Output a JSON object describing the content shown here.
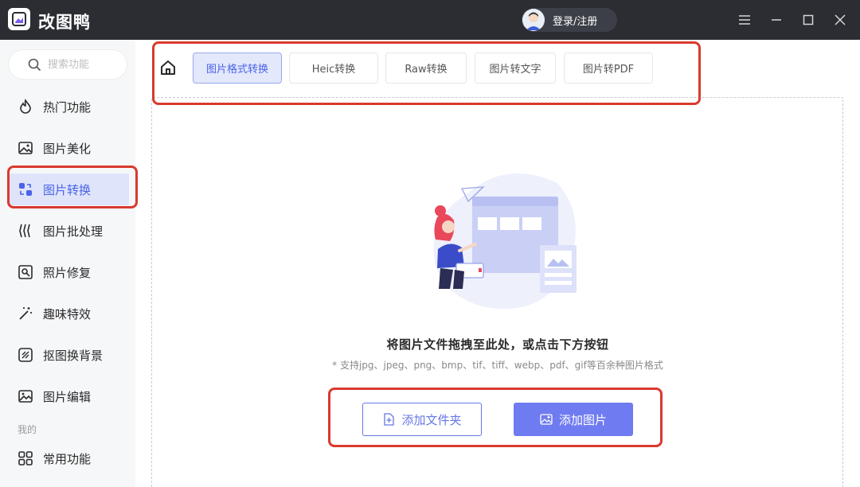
{
  "app": {
    "title": "改图鸭",
    "login_label": "登录/注册"
  },
  "window_controls": [
    "menu-icon",
    "minimize-icon",
    "maximize-icon",
    "close-icon"
  ],
  "search": {
    "placeholder": "搜索功能"
  },
  "sidebar": {
    "items": [
      {
        "label": "热门功能",
        "icon": "fire-icon"
      },
      {
        "label": "图片美化",
        "icon": "image-beautify-icon"
      },
      {
        "label": "图片转换",
        "icon": "convert-icon",
        "active": true
      },
      {
        "label": "图片批处理",
        "icon": "batch-icon"
      },
      {
        "label": "照片修复",
        "icon": "photo-repair-icon"
      },
      {
        "label": "趣味特效",
        "icon": "magic-wand-icon"
      },
      {
        "label": "抠图换背景",
        "icon": "cutout-icon"
      },
      {
        "label": "图片编辑",
        "icon": "image-edit-icon"
      }
    ],
    "section_label": "我的",
    "mine_items": [
      {
        "label": "常用功能",
        "icon": "grid-icon"
      }
    ]
  },
  "tabs": [
    {
      "label": "图片格式转换",
      "active": true
    },
    {
      "label": "Heic转换"
    },
    {
      "label": "Raw转换"
    },
    {
      "label": "图片转文字"
    },
    {
      "label": "图片转PDF"
    }
  ],
  "dropzone": {
    "title": "将图片文件拖拽至此处，或点击下方按钮",
    "subtitle": "* 支持jpg、jpeg、png、bmp、tif、tiff、webp、pdf、gif等百余种图片格式",
    "add_folder_label": "添加文件夹",
    "add_image_label": "添加图片"
  },
  "colors": {
    "accent": "#6f7bf1",
    "active_text": "#4a63e8",
    "highlight": "#d93a2f",
    "titlebar": "#2b2d33"
  }
}
